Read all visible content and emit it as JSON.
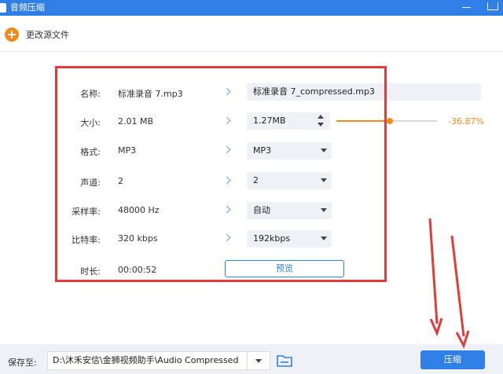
{
  "window": {
    "title": "音频压缩"
  },
  "toolbar": {
    "change_source_label": "更改源文件"
  },
  "form": {
    "rows": [
      {
        "label": "名称:",
        "original": "标准录音 7.mp3",
        "target": "标准录音 7_compressed.mp3"
      },
      {
        "label": "大小:",
        "original": "2.01 MB",
        "target": "1.27MB"
      },
      {
        "label": "格式:",
        "original": "MP3",
        "target": "MP3"
      },
      {
        "label": "声道:",
        "original": "2",
        "target": "2"
      },
      {
        "label": "采样率:",
        "original": "48000 Hz",
        "target": "自动"
      },
      {
        "label": "比特率:",
        "original": "320 kbps",
        "target": "192kbps"
      },
      {
        "label": "时长:",
        "original": "00:00:52"
      }
    ],
    "compression_percent": "-36.87%",
    "slider_level": 0.53,
    "preview_label": "预览"
  },
  "footer": {
    "save_label": "保存至:",
    "save_path": "D:\\沐禾安信\\金狮视频助手\\Audio Compressed",
    "compress_label": "压缩"
  },
  "colors": {
    "accent": "#2f7fe6",
    "orange": "#f08a18",
    "annotation": "#e23b3b"
  }
}
